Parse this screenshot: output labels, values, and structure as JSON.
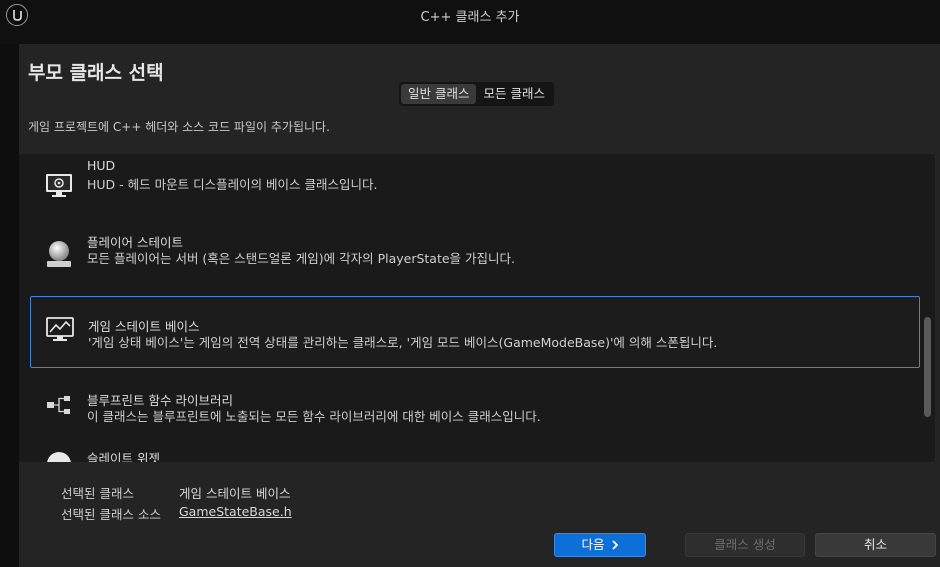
{
  "window": {
    "title": "C++ 클래스 추가"
  },
  "header": {
    "title": "부모 클래스 선택",
    "description": "게임 프로젝트에 C++ 헤더와 소스 코드 파일이 추가됩니다."
  },
  "tabs": [
    {
      "label": "일반 클래스",
      "active": true
    },
    {
      "label": "모든 클래스",
      "active": false
    }
  ],
  "class_list": {
    "items": [
      {
        "name": "HUD",
        "desc": "HUD - 헤드 마운트 디스플레이의 베이스 클래스입니다.",
        "icon": "monitor-icon",
        "selected": false
      },
      {
        "name": "플레이어 스테이트",
        "desc": "모든 플레이어는 서버 (혹은 스탠드얼론 게임)에 각자의 PlayerState을  가집니다.",
        "icon": "player-state-icon",
        "selected": false
      },
      {
        "name": "게임 스테이트 베이스",
        "desc": "'게임 상태 베이스'는 게임의 전역 상태를 관리하는 클래스로, '게임 모드 베이스(GameModeBase)'에 의해 스폰됩니다.",
        "icon": "chart-monitor-icon",
        "selected": true
      },
      {
        "name": "블루프린트 함수 라이브러리",
        "desc": "이 클래스는 블루프린트에 노출되는 모든 함수 라이브러리에 대한 베이스 클래스입니다.",
        "icon": "node-graph-icon",
        "selected": false
      },
      {
        "name": "슬레이트 위젯",
        "icon": "slate-widget-icon",
        "selected": false
      }
    ]
  },
  "selection": {
    "class_label": "선택된 클래스",
    "class_value": "게임 스테이트 베이스",
    "source_label": "선택된 클래스 소스",
    "source_value": "GameStateBase.h"
  },
  "buttons": {
    "next": "다음",
    "create": "클래스 생성",
    "cancel": "취소"
  },
  "colors": {
    "accent": "#0f6fd8",
    "selected_border": "#3f86d9"
  }
}
